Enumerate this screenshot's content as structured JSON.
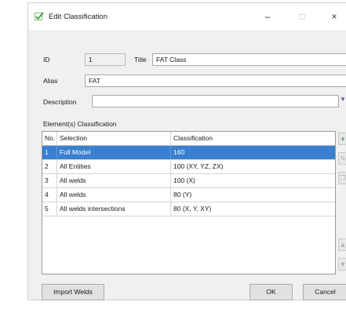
{
  "window": {
    "title": "Edit Classification"
  },
  "title_controls": {
    "minimize": "–",
    "maximize": "□",
    "close": "×"
  },
  "form": {
    "id_label": "ID",
    "id_value": "1",
    "title_label": "Title",
    "title_value": "FAT Class",
    "alias_label": "Alias",
    "alias_value": "FAT",
    "description_label": "Description",
    "description_value": ""
  },
  "section": {
    "label": "Element(s) Classification"
  },
  "table": {
    "headers": [
      "No.",
      "Selection",
      "Classification"
    ],
    "rows": [
      {
        "no": "1",
        "selection": "Full Model",
        "classification": "160",
        "selected": true
      },
      {
        "no": "2",
        "selection": "All Entities",
        "classification": "100 (XY, YZ, ZX)",
        "selected": false
      },
      {
        "no": "3",
        "selection": "All welds",
        "classification": "100 (X)",
        "selected": false
      },
      {
        "no": "4",
        "selection": "All welds",
        "classification": "80 (Y)",
        "selected": false
      },
      {
        "no": "5",
        "selection": "All welds intersections",
        "classification": "80 (X, Y, XY)",
        "selected": false
      }
    ]
  },
  "buttons": {
    "import": "Import Welds",
    "ok": "OK",
    "cancel": "Cancel"
  }
}
